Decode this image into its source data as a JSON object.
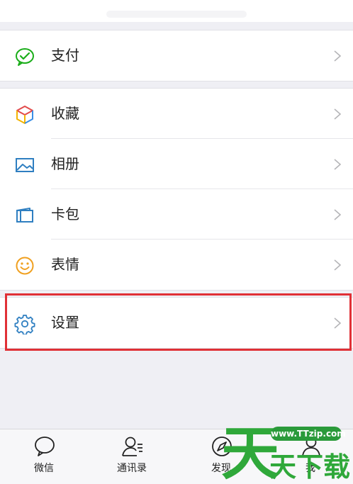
{
  "menu": {
    "groups": [
      {
        "items": [
          {
            "label": "支付",
            "icon": "wechat-pay-icon"
          }
        ]
      },
      {
        "items": [
          {
            "label": "收藏",
            "icon": "favorites-cube-icon"
          },
          {
            "label": "相册",
            "icon": "album-icon"
          },
          {
            "label": "卡包",
            "icon": "card-wallet-icon"
          },
          {
            "label": "表情",
            "icon": "emoji-icon"
          }
        ]
      },
      {
        "items": [
          {
            "label": "设置",
            "icon": "gear-icon"
          }
        ]
      }
    ]
  },
  "tabbar": {
    "tabs": [
      {
        "label": "微信",
        "icon": "chat-bubble-icon"
      },
      {
        "label": "通讯录",
        "icon": "contacts-icon"
      },
      {
        "label": "发现",
        "icon": "compass-icon"
      },
      {
        "label": "我",
        "icon": "person-icon"
      }
    ]
  },
  "watermark": {
    "url": "www.TTzip.com",
    "text": "天天下载"
  },
  "colors": {
    "accent_green": "#1aad19",
    "highlight_red": "#e03036"
  }
}
